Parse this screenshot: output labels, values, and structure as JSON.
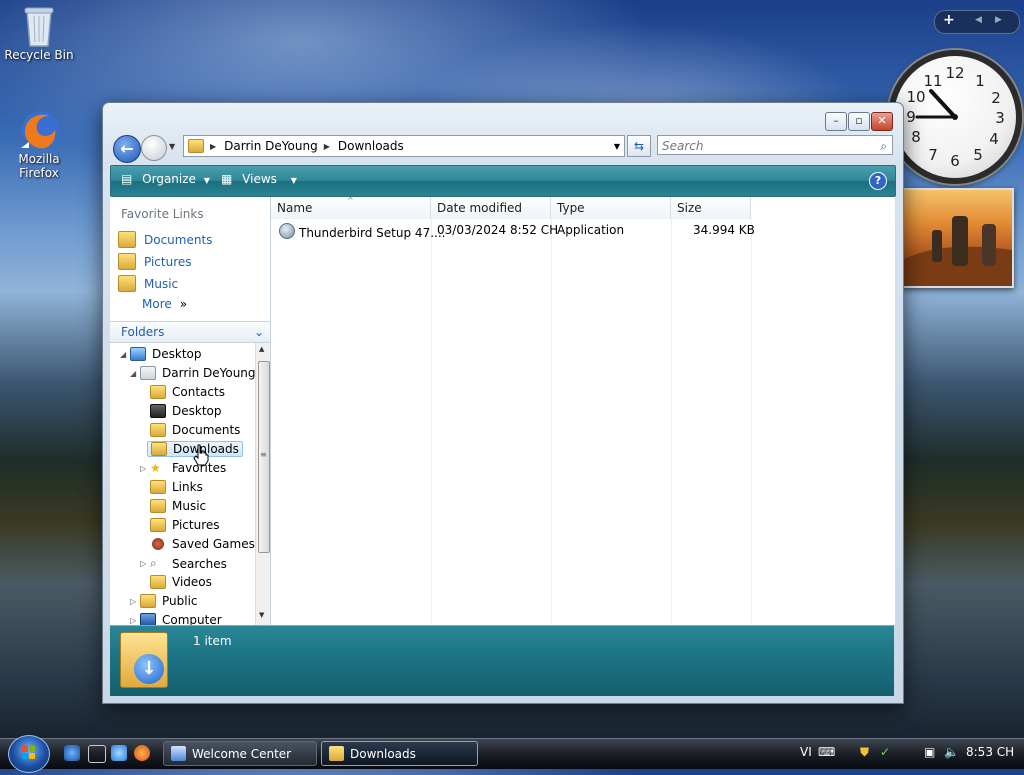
{
  "desktop": {
    "icons": [
      {
        "label": "Recycle Bin"
      },
      {
        "label_line1": "Mozilla",
        "label_line2": "Firefox"
      }
    ]
  },
  "window": {
    "address": {
      "segments": [
        "Darrin DeYoung",
        "Downloads"
      ]
    },
    "search_placeholder": "Search",
    "commands": {
      "organize": "Organize",
      "views": "Views",
      "help": "?"
    },
    "favorite_links": {
      "heading": "Favorite Links",
      "items": [
        "Documents",
        "Pictures",
        "Music"
      ],
      "more": "More"
    },
    "folders_heading": "Folders",
    "tree": [
      "Desktop",
      "Darrin DeYoung",
      "Contacts",
      "Desktop",
      "Documents",
      "Downloads",
      "Favorites",
      "Links",
      "Music",
      "Pictures",
      "Saved Games",
      "Searches",
      "Videos",
      "Public",
      "Computer"
    ],
    "columns": [
      "Name",
      "Date modified",
      "Type",
      "Size"
    ],
    "files": [
      {
        "name": "Thunderbird Setup 47....",
        "date": "03/03/2024 8:52 CH",
        "type": "Application",
        "size": "34.994 KB"
      }
    ],
    "status": "1 item"
  },
  "taskbar": {
    "tasks": [
      "Welcome Center",
      "Downloads"
    ],
    "language": "VI",
    "time": "8:53 CH"
  },
  "colors": {
    "command_bar": "#2f8797",
    "details_pane": "#1c7585",
    "link": "#1f5fb3"
  }
}
